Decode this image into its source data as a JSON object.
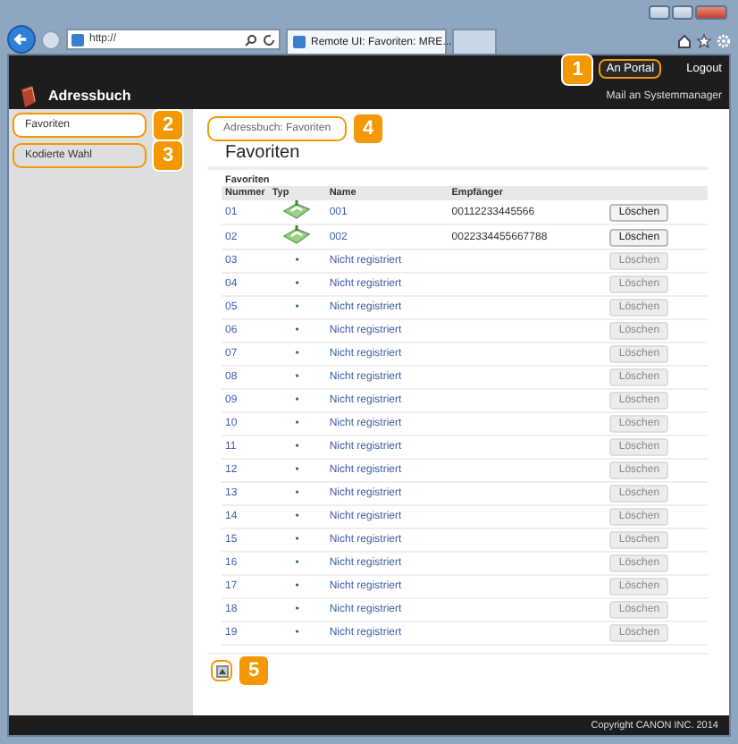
{
  "browser": {
    "address": "http://",
    "tab_title": "Remote UI: Favoriten: MRE..."
  },
  "header": {
    "portal_button": {
      "label": "An Portal",
      "callout": "1"
    },
    "logout": "Logout",
    "title": "Adressbuch",
    "mail_link": "Mail an Systemmanager"
  },
  "sidebar": {
    "items": [
      {
        "label": "Favoriten",
        "selected": true,
        "callout": "2"
      },
      {
        "label": "Kodierte Wahl",
        "selected": false,
        "callout": "3"
      }
    ]
  },
  "breadcrumb": {
    "label": "Adressbuch: Favoriten",
    "callout": "4"
  },
  "page_title": "Favoriten",
  "table": {
    "caption": "Favoriten",
    "columns": [
      "Nummer",
      "Typ",
      "Name",
      "Empfänger"
    ],
    "rows": [
      {
        "number": "01",
        "kind": "registered",
        "name": "001",
        "recipient": "00112233445566",
        "delete": "Löschen",
        "disabled": false
      },
      {
        "number": "02",
        "kind": "registered",
        "name": "002",
        "recipient": "0022334455667788",
        "delete": "Löschen",
        "disabled": false
      },
      {
        "number": "03",
        "kind": "empty",
        "type": "•",
        "name": "Nicht registriert",
        "delete": "Löschen",
        "disabled": true
      },
      {
        "number": "04",
        "kind": "empty",
        "type": "•",
        "name": "Nicht registriert",
        "delete": "Löschen",
        "disabled": true
      },
      {
        "number": "05",
        "kind": "empty",
        "type": "•",
        "name": "Nicht registriert",
        "delete": "Löschen",
        "disabled": true
      },
      {
        "number": "06",
        "kind": "empty",
        "type": "•",
        "name": "Nicht registriert",
        "delete": "Löschen",
        "disabled": true
      },
      {
        "number": "07",
        "kind": "empty",
        "type": "•",
        "name": "Nicht registriert",
        "delete": "Löschen",
        "disabled": true
      },
      {
        "number": "08",
        "kind": "empty",
        "type": "•",
        "name": "Nicht registriert",
        "delete": "Löschen",
        "disabled": true
      },
      {
        "number": "09",
        "kind": "empty",
        "type": "•",
        "name": "Nicht registriert",
        "delete": "Löschen",
        "disabled": true
      },
      {
        "number": "10",
        "kind": "empty",
        "type": "•",
        "name": "Nicht registriert",
        "delete": "Löschen",
        "disabled": true
      },
      {
        "number": "11",
        "kind": "empty",
        "type": "•",
        "name": "Nicht registriert",
        "delete": "Löschen",
        "disabled": true
      },
      {
        "number": "12",
        "kind": "empty",
        "type": "•",
        "name": "Nicht registriert",
        "delete": "Löschen",
        "disabled": true
      },
      {
        "number": "13",
        "kind": "empty",
        "type": "•",
        "name": "Nicht registriert",
        "delete": "Löschen",
        "disabled": true
      },
      {
        "number": "14",
        "kind": "empty",
        "type": "•",
        "name": "Nicht registriert",
        "delete": "Löschen",
        "disabled": true
      },
      {
        "number": "15",
        "kind": "empty",
        "type": "•",
        "name": "Nicht registriert",
        "delete": "Löschen",
        "disabled": true
      },
      {
        "number": "16",
        "kind": "empty",
        "type": "•",
        "name": "Nicht registriert",
        "delete": "Löschen",
        "disabled": true
      },
      {
        "number": "17",
        "kind": "empty",
        "type": "•",
        "name": "Nicht registriert",
        "delete": "Löschen",
        "disabled": true
      },
      {
        "number": "18",
        "kind": "empty",
        "type": "•",
        "name": "Nicht registriert",
        "delete": "Löschen",
        "disabled": true
      },
      {
        "number": "19",
        "kind": "empty",
        "type": "•",
        "name": "Nicht registriert",
        "delete": "Löschen",
        "disabled": true
      }
    ]
  },
  "top_link": {
    "callout": "5"
  },
  "footer": "Copyright CANON INC. 2014"
}
